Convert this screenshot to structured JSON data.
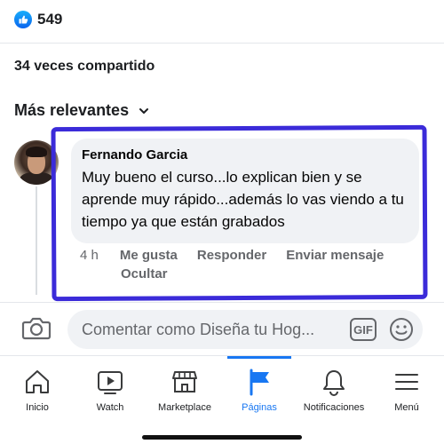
{
  "reactions": {
    "count": "549",
    "icon": "like-icon",
    "color": "#1877f2"
  },
  "shares": {
    "text": "34 veces compartido"
  },
  "sort": {
    "label": "Más relevantes",
    "icon": "chevron-down-icon"
  },
  "comment": {
    "author": "Fernando Garcia",
    "text": "Muy bueno el curso...lo explican bien y se aprende muy rápido...además lo vas viendo a tu tiempo ya que están grabados",
    "time": "4 h",
    "like_label": "Me gusta",
    "reply_label": "Responder",
    "message_label": "Enviar mensaje",
    "hide_label": "Ocultar"
  },
  "composer": {
    "placeholder": "Comentar como Diseña tu Hog...",
    "gif_label": "GIF",
    "camera_icon": "camera-icon",
    "emoji_icon": "emoji-icon"
  },
  "tabbar": {
    "active_color": "#1877f2",
    "tabs": [
      {
        "label": "Inicio",
        "icon": "home-icon",
        "active": false
      },
      {
        "label": "Watch",
        "icon": "video-icon",
        "active": false
      },
      {
        "label": "Marketplace",
        "icon": "shop-icon",
        "active": false
      },
      {
        "label": "Páginas",
        "icon": "flag-icon",
        "active": true
      },
      {
        "label": "Notificaciones",
        "icon": "bell-icon",
        "active": false
      },
      {
        "label": "Menú",
        "icon": "menu-icon",
        "active": false
      }
    ]
  },
  "annotation": {
    "color": "#3b2bd9"
  }
}
